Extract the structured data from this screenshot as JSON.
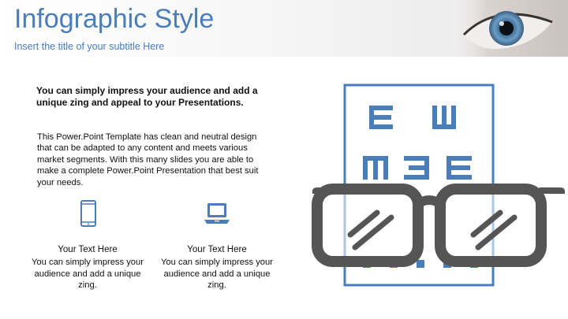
{
  "header": {
    "title": "Infographic Style",
    "subtitle": "Insert the title of your subtitle Here"
  },
  "content": {
    "lead": "You can simply impress your audience and add a unique zing and appeal to your Presentations.",
    "body": "This Power.Point Template has clean and neutral design that can be adapted to any content and meets various market segments. With this many slides you are able to make a complete Power.Point Presentation that best suit your needs."
  },
  "columns": [
    {
      "icon": "smartphone-icon",
      "heading": "Your Text  Here",
      "text": "You can simply impress your audience and add a unique zing."
    },
    {
      "icon": "laptop-icon",
      "heading": "Your Text  Here",
      "text": "You can simply impress your audience and add a unique zing."
    }
  ],
  "colors": {
    "accent": "#4a7ebb",
    "glasses": "#555555"
  }
}
